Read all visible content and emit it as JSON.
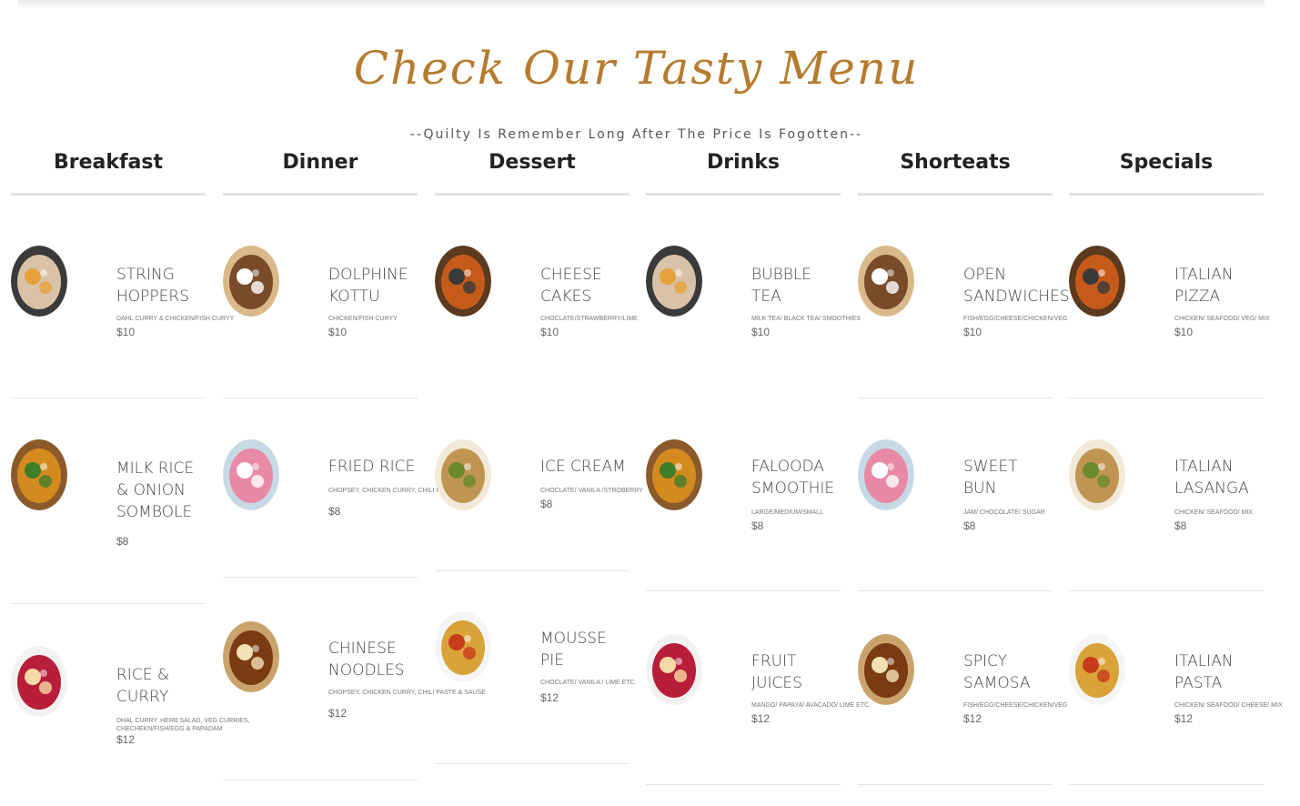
{
  "page": {
    "title": "Check Our Tasty Menu",
    "subtitle": "--Quilty Is Remember Long After The Price Is Fogotten--"
  },
  "colors": {
    "accent": "#b57b2e",
    "rule": "#e3e3e3"
  },
  "columns": [
    {
      "heading": "Breakfast",
      "items": [
        {
          "name": "STRING\nHOPPERS",
          "desc": "DAHL CURRY & CHICKEN/FISH CURYY",
          "price": "$10",
          "icon": "string-hoppers-image"
        },
        {
          "name": "MILK RICE\n& ONION\nSOMBOLE",
          "desc": "",
          "price": "$8",
          "icon": "milk-rice-image"
        },
        {
          "name": "RICE &\nCURRY",
          "desc": "DHAL CURRY, HERB SALAD, VEG CURRIES, CHECHEKN/FISH/EGG & PAPADAM",
          "price": "$12",
          "icon": "rice-curry-image"
        }
      ]
    },
    {
      "heading": "Dinner",
      "items": [
        {
          "name": "DOLPHINE\nKOTTU",
          "desc": "CHICKEN/FISH CURYY",
          "price": "$10",
          "icon": "kottu-image"
        },
        {
          "name": "FRIED RICE",
          "desc": "CHOPSEY, CHICKEN CURRY, CHILI PASTE & SAUSE",
          "price": "$8",
          "icon": "fried-rice-image"
        },
        {
          "name": "CHINESE\nNOODLES",
          "desc": "CHOPSEY, CHICKEN CURRY, CHILI PASTE & SAUSE",
          "price": "$12",
          "icon": "noodles-image"
        }
      ]
    },
    {
      "heading": "Dessert",
      "items": [
        {
          "name": "CHEESE\nCAKES",
          "desc": "CHOCLATE/STRAWBERRY/LIME",
          "price": "$10",
          "icon": "cheese-cake-image"
        },
        {
          "name": "ICE CREAM",
          "desc": "CHOCLATE/ VANILA /STROBERRY",
          "price": "$8",
          "icon": "ice-cream-image"
        },
        {
          "name": "MOUSSE\nPIE",
          "desc": "CHOCLATE/ VANILA / LIME ETC.",
          "price": "$12",
          "icon": "mousse-pie-image"
        }
      ]
    },
    {
      "heading": "Drinks",
      "items": [
        {
          "name": "BUBBLE\nTEA",
          "desc": "MILK TEA/ BLACK TEA/ SMOOTHIES",
          "price": "$10",
          "icon": "bubble-tea-image"
        },
        {
          "name": "FALOODA\nSMOOTHIE",
          "desc": "LARGE/MEDIUM/SMALL",
          "price": "$8",
          "icon": "falooda-image"
        },
        {
          "name": "FRUIT\nJUICES",
          "desc": "MANGO/ PAPAYA/ AVACADO/ LIME ETC.",
          "price": "$12",
          "icon": "fruit-juice-image"
        }
      ]
    },
    {
      "heading": "Shorteats",
      "items": [
        {
          "name": "OPEN\nSANDWICHES",
          "desc": "FISH/EGG/CHEESE/CHICKEN/VEG",
          "price": "$10",
          "icon": "sandwich-image"
        },
        {
          "name": "SWEET\nBUN",
          "desc": "JAM/ CHOCOLATE/ SUGAR",
          "price": "$8",
          "icon": "sweet-bun-image"
        },
        {
          "name": "SPICY\nSAMOSA",
          "desc": "FISH/EGG/CHEESE/CHICKEN/VEG",
          "price": "$12",
          "icon": "samosa-image"
        }
      ]
    },
    {
      "heading": "Specials",
      "items": [
        {
          "name": "ITALIAN\nPIZZA",
          "desc": "CHICKEN/ SEAFOOD/ VEG/ MIX",
          "price": "$10",
          "icon": "pizza-image"
        },
        {
          "name": "ITALIAN\nLASANGA",
          "desc": "CHICKEN/ SEAFOOD/ MIX",
          "price": "$8",
          "icon": "lasagna-image"
        },
        {
          "name": "ITALIAN\nPASTA",
          "desc": "CHICKEN/ SEAFOOD/ CHEESE/ MIX",
          "price": "$12",
          "icon": "pasta-image"
        }
      ]
    }
  ]
}
